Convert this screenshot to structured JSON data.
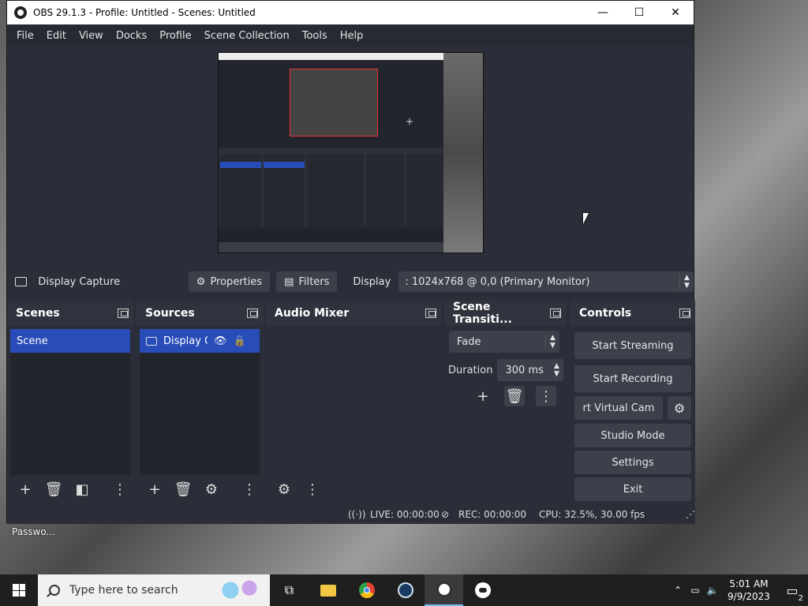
{
  "desktop": {
    "icon_label_partial": "Passwo..."
  },
  "window": {
    "title": "OBS 29.1.3 - Profile: Untitled - Scenes: Untitled",
    "minimize": "—",
    "maximize": "☐",
    "close": "✕"
  },
  "menu": [
    "File",
    "Edit",
    "View",
    "Docks",
    "Profile",
    "Scene Collection",
    "Tools",
    "Help"
  ],
  "source_toolbar": {
    "source_name": "Display Capture",
    "properties_label": "Properties",
    "filters_label": "Filters",
    "display_label": "Display",
    "display_value": ": 1024x768 @ 0,0 (Primary Monitor)"
  },
  "docks": {
    "scenes": {
      "title": "Scenes",
      "items": [
        "Scene"
      ]
    },
    "sources": {
      "title": "Sources",
      "items": [
        "Display Ca"
      ]
    },
    "audio_mixer": {
      "title": "Audio Mixer"
    },
    "transitions": {
      "title": "Scene Transiti...",
      "transition_value": "Fade",
      "duration_label": "Duration",
      "duration_value": "300 ms"
    },
    "controls": {
      "title": "Controls",
      "start_streaming": "Start Streaming",
      "start_recording": "Start Recording",
      "virtual_cam": "rt Virtual Cam",
      "studio_mode": "Studio Mode",
      "settings": "Settings",
      "exit": "Exit"
    }
  },
  "status": {
    "live": "LIVE: 00:00:00",
    "rec": "REC: 00:00:00",
    "cpu": "CPU: 32.5%, 30.00 fps"
  },
  "taskbar": {
    "search_placeholder": "Type here to search",
    "time": "5:01 AM",
    "date": "9/9/2023",
    "notification_count": "2"
  }
}
